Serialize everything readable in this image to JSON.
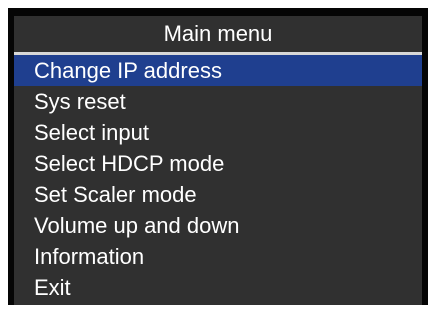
{
  "menu": {
    "title": "Main menu",
    "selected_index": 0,
    "items": [
      {
        "label": "Change IP address",
        "selected": true
      },
      {
        "label": "Sys reset",
        "selected": false
      },
      {
        "label": "Select input",
        "selected": false
      },
      {
        "label": "Select HDCP mode",
        "selected": false
      },
      {
        "label": "Set Scaler mode",
        "selected": false
      },
      {
        "label": "Volume up and down",
        "selected": false
      },
      {
        "label": "Information",
        "selected": false
      },
      {
        "label": "Exit",
        "selected": false
      }
    ]
  },
  "colors": {
    "panel_background": "#303030",
    "frame_background": "#050505",
    "selection_highlight": "#1f3f8f",
    "text": "#ffffff"
  }
}
